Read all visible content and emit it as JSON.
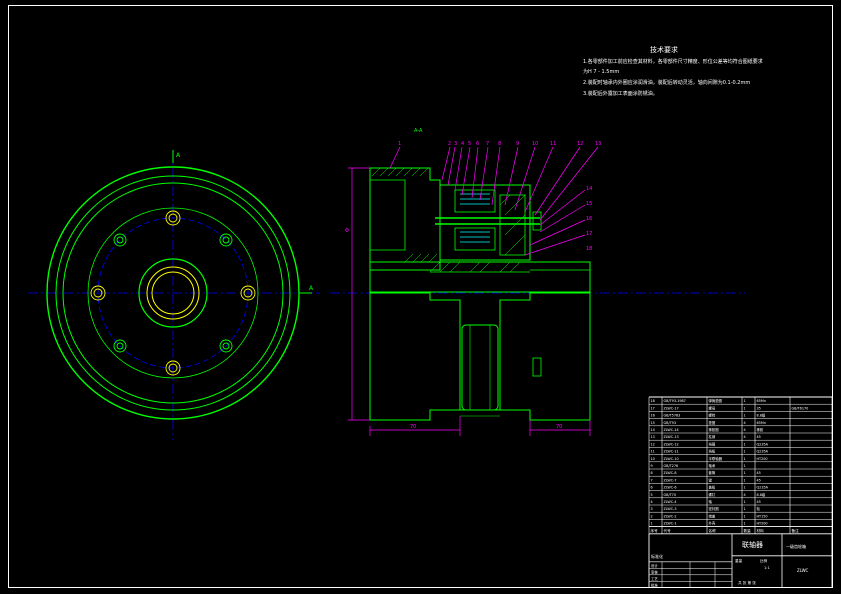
{
  "drawing": {
    "section_marks": {
      "view_a_top": "A",
      "view_a_right": "A",
      "center_label": "A-A"
    },
    "tech_requirements": {
      "title": "技术要求",
      "lines": [
        "1.各零部件加工前应检查其材料，各零部件尺寸精度、形位公差等均符合图纸要求",
        "为H 7 - 1.5mm",
        "2.装配时轴承内外圈应涂润滑油，装配后转动灵活，轴向间隙为0.1-0.2mm",
        "3.装配后外露加工表面涂防锈油。"
      ]
    },
    "balloons": [
      "1",
      "2",
      "3",
      "4",
      "5",
      "6",
      "7",
      "8",
      "9",
      "10",
      "11",
      "12",
      "13",
      "14",
      "15",
      "16",
      "17",
      "18"
    ],
    "dimensions": {
      "left_height": "Φ",
      "bottom_left": "70",
      "bottom_right": "70"
    },
    "title_block": {
      "part_name": "联轴器",
      "drawing_no": "ZLWC",
      "material_heading": "一级齿轮箱",
      "scale": "1:1",
      "rows": [
        [
          "18",
          "GB/T93-1987",
          "弹簧垫圈",
          "1",
          "65Mn",
          ""
        ],
        [
          "17",
          "ZLWC-17",
          "螺母",
          "1",
          "35",
          "GB/T6170"
        ],
        [
          "16",
          "GB/T5783",
          "螺栓",
          "1",
          "8.8级",
          ""
        ],
        [
          "15",
          "GB/T93",
          "垫圈",
          "4",
          "65Mn",
          ""
        ],
        [
          "14",
          "ZLWC-14",
          "橡胶圈",
          "4",
          "橡胶",
          ""
        ],
        [
          "13",
          "ZLWC-13",
          "柱销",
          "4",
          "45",
          ""
        ],
        [
          "12",
          "ZLWC-12",
          "挡圈",
          "1",
          "Q235A",
          ""
        ],
        [
          "11",
          "ZLWC-11",
          "挡板",
          "1",
          "Q235A",
          ""
        ],
        [
          "10",
          "ZLWC-10",
          "半联轴器",
          "1",
          "HT200",
          ""
        ],
        [
          "9",
          "GB/T276",
          "轴承",
          "1",
          "",
          ""
        ],
        [
          "8",
          "ZLWC-8",
          "套筒",
          "1",
          "45",
          ""
        ],
        [
          "7",
          "ZLWC-7",
          "键",
          "1",
          "45",
          ""
        ],
        [
          "6",
          "ZLWC-6",
          "盖板",
          "1",
          "Q235A",
          ""
        ],
        [
          "5",
          "GB/T70",
          "螺钉",
          "4",
          "8.8级",
          ""
        ],
        [
          "4",
          "ZLWC-4",
          "轴",
          "1",
          "45",
          ""
        ],
        [
          "3",
          "ZLWC-3",
          "密封圈",
          "1",
          "毡",
          ""
        ],
        [
          "2",
          "ZLWC-2",
          "端盖",
          "1",
          "HT150",
          ""
        ],
        [
          "1",
          "ZLWC-1",
          "外壳",
          "1",
          "HT200",
          ""
        ]
      ],
      "header_row": [
        "序号",
        "代号",
        "名称",
        "数量",
        "材料",
        "备注"
      ],
      "sign_rows": [
        "设计",
        "审核",
        "工艺",
        "批准"
      ],
      "school": "标准化",
      "weight_label": "重量",
      "scale_label": "比例",
      "sheet_label": "共 张 第 张"
    }
  },
  "colors": {
    "bg": "#000000",
    "frame": "#ffffff",
    "green": "#00ff00",
    "magenta": "#ff00ff",
    "blue": "#0000ff",
    "red": "#ff0000",
    "yellow": "#ffff00",
    "cyan": "#00ffff"
  }
}
